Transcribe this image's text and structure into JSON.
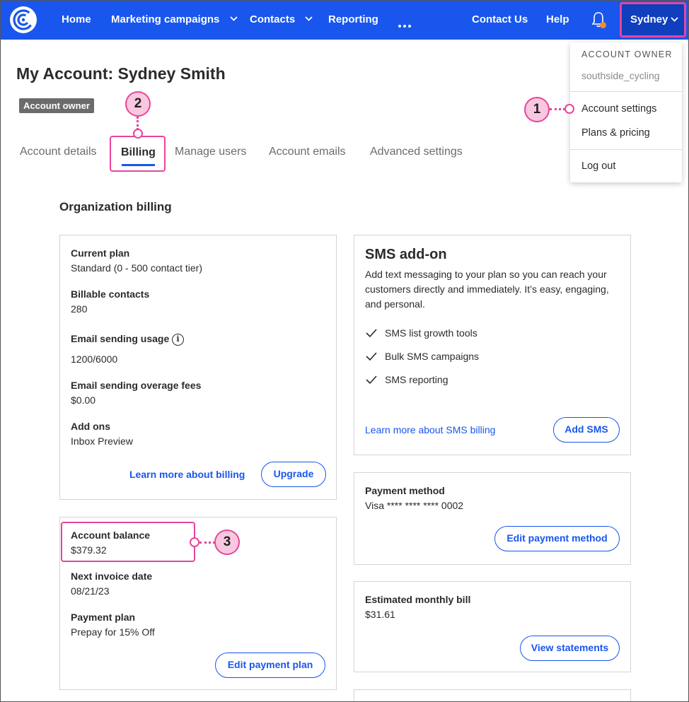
{
  "nav": {
    "home": "Home",
    "marketing": "Marketing campaigns",
    "contacts": "Contacts",
    "reporting": "Reporting",
    "contact_us": "Contact Us",
    "help": "Help",
    "user": "Sydney",
    "brand_color": "#1856ed"
  },
  "account_menu": {
    "header": "ACCOUNT OWNER",
    "username": "southside_cycling",
    "items": [
      "Account settings",
      "Plans & pricing",
      "Log out"
    ]
  },
  "page": {
    "title": "My Account: Sydney Smith",
    "badge": "Account owner",
    "tabs": [
      "Account details",
      "Billing",
      "Manage users",
      "Account emails",
      "Advanced settings"
    ],
    "active_tab": "Billing",
    "section_title": "Organization billing"
  },
  "callouts": [
    "1",
    "2",
    "3"
  ],
  "plan_card": {
    "current_plan_label": "Current plan",
    "current_plan_value": "Standard (0 - 500 contact tier)",
    "billable_label": "Billable contacts",
    "billable_value": "280",
    "usage_label": "Email sending usage",
    "usage_value": "1200/6000",
    "overage_label": "Email sending overage fees",
    "overage_value": "$0.00",
    "addons_label": "Add ons",
    "addons_value": "Inbox Preview",
    "learn_link": "Learn more about billing",
    "upgrade_button": "Upgrade"
  },
  "balance_card": {
    "balance_label": "Account balance",
    "balance_value": "$379.32",
    "invoice_label": "Next invoice date",
    "invoice_value": "08/21/23",
    "payment_plan_label": "Payment plan",
    "payment_plan_value": "Prepay for 15% Off",
    "edit_button": "Edit payment plan"
  },
  "sms_card": {
    "title": "SMS add-on",
    "description": "Add text messaging to your plan so you can reach your customers directly and immediately. It’s easy, engaging, and personal.",
    "features": [
      "SMS list growth tools",
      "Bulk SMS campaigns",
      "SMS reporting"
    ],
    "learn_link": "Learn more about SMS billing",
    "add_button": "Add SMS"
  },
  "payment_card": {
    "label": "Payment method",
    "value": "Visa **** **** **** 0002",
    "edit_button": "Edit payment method"
  },
  "estimate_card": {
    "label": "Estimated monthly bill",
    "value": "$31.61",
    "statements_button": "View statements"
  },
  "colors": {
    "accent": "#1856ed",
    "highlight": "#e8449a",
    "callout_fill": "#f9c8e0",
    "notification_dot": "#f58a2c"
  }
}
